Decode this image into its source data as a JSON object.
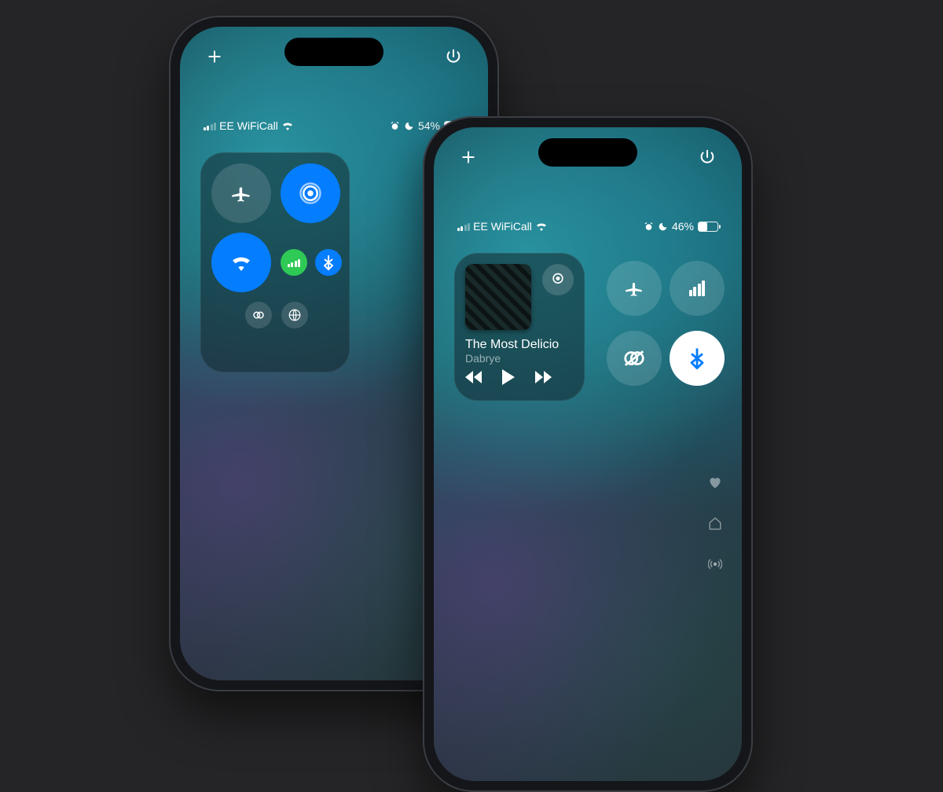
{
  "left_phone": {
    "carrier": "EE WiFiCall",
    "battery_percent": "54%",
    "battery_fill": 54,
    "signal_bars_active": 2,
    "toggles": {
      "airplane": "Airplane Mode",
      "airdrop": "AirDrop",
      "wifi": "Wi-Fi",
      "cellular": "Cellular Data",
      "bluetooth": "Bluetooth",
      "hotspot": "Personal Hotspot",
      "vpn": "VPN"
    }
  },
  "right_phone": {
    "carrier": "EE WiFiCall",
    "battery_percent": "46%",
    "battery_fill": 46,
    "signal_bars_active": 2,
    "now_playing": {
      "track": "The Most Delicio",
      "artist": "Dabrye",
      "airplay_label": "AirPlay"
    },
    "toggles": {
      "airplane": "Airplane Mode",
      "cellular": "Cellular Data",
      "hotspot": "Personal Hotspot",
      "bluetooth": "Bluetooth"
    },
    "sidebar": {
      "favorites": "Favorites",
      "home": "Home",
      "connectivity": "Connectivity"
    }
  },
  "colors": {
    "accent_blue": "#0a7cff",
    "accent_green": "#34c759"
  }
}
